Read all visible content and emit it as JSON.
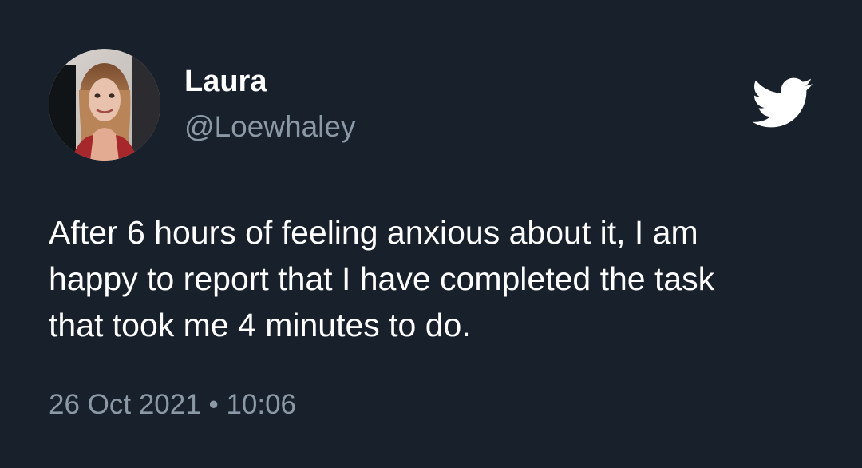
{
  "author": {
    "display_name": "Laura",
    "handle": "@Loewhaley"
  },
  "tweet": {
    "lines": [
      "After 6 hours of feeling anxious about it, I am",
      "happy to report that I have completed the task",
      "that took me 4 minutes to do."
    ]
  },
  "meta": {
    "date": "26 Oct 2021",
    "separator": "•",
    "time": "10:06"
  },
  "icons": {
    "brand": "twitter-bird-icon",
    "avatar": "profile-photo"
  },
  "colors": {
    "background": "#17202b",
    "primary_text": "#ffffff",
    "secondary_text": "#8b98a5"
  }
}
